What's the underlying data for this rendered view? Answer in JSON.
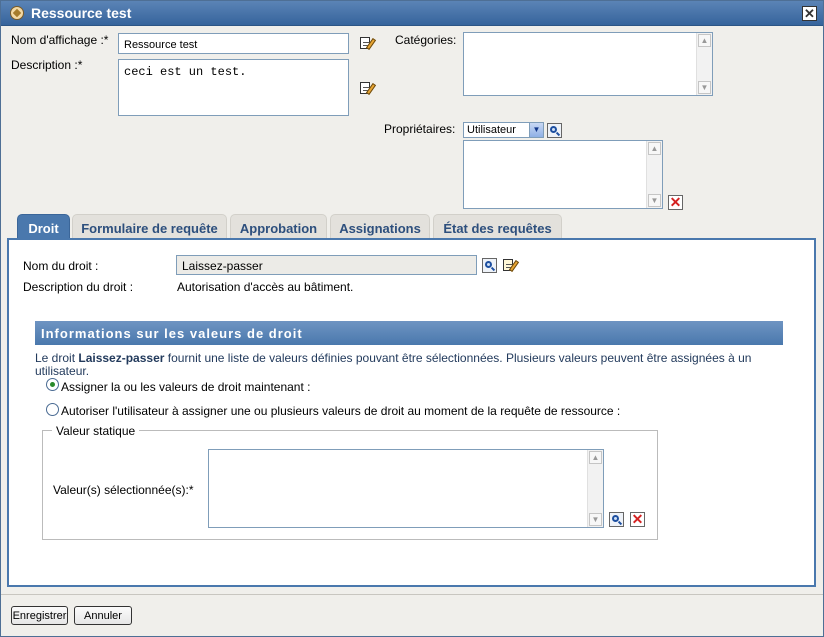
{
  "window": {
    "title": "Ressource test"
  },
  "form": {
    "display_name_label": "Nom d'affichage :*",
    "display_name_value": "Ressource test",
    "description_label": "Description :*",
    "description_value": "ceci est un test.",
    "categories_label": "Catégories:",
    "owners_label": "Propriétaires:",
    "owners_select_value": "Utilisateur"
  },
  "tabs": [
    {
      "label": "Droit",
      "active": true
    },
    {
      "label": "Formulaire de requête",
      "active": false
    },
    {
      "label": "Approbation",
      "active": false
    },
    {
      "label": "Assignations",
      "active": false
    },
    {
      "label": "État des requêtes",
      "active": false
    }
  ],
  "entitlement": {
    "name_label": "Nom du droit :",
    "name_value": "Laissez-passer",
    "desc_label": "Description du droit :",
    "desc_value": "Autorisation d'accès au bâtiment."
  },
  "values_section": {
    "header": "Informations sur les valeurs de droit",
    "info_prefix": "Le droit ",
    "info_bold": "Laissez-passer",
    "info_suffix": " fournit une liste de valeurs définies pouvant être sélectionnées. Plusieurs valeurs peuvent être assignées à un",
    "info_line2": "utilisateur.",
    "radio_now_label": "Assigner la ou les valeurs de droit maintenant :",
    "radio_now_checked": true,
    "radio_user_label": "Autoriser l'utilisateur à assigner une ou plusieurs valeurs de droit au moment de la requête de ressource :",
    "radio_user_checked": false,
    "static_legend": "Valeur statique",
    "selected_values_label": "Valeur(s) sélectionnée(s):*"
  },
  "footer": {
    "save_label": "Enregistrer",
    "cancel_label": "Annuler"
  }
}
